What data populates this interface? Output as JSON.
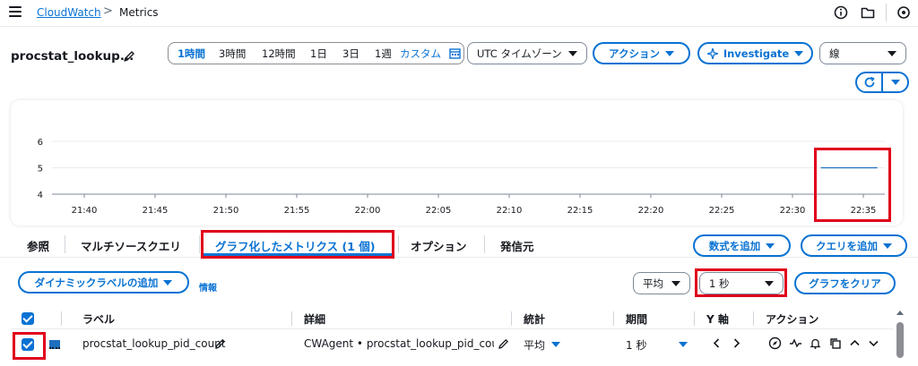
{
  "breadcrumb": {
    "root": "CloudWatch",
    "separator": ">",
    "current": "Metrics"
  },
  "title": {
    "text": "procstat_lookup..."
  },
  "time_range": {
    "options": [
      "1時間",
      "3時間",
      "12時間",
      "1日",
      "3日",
      "1週"
    ],
    "selected": "1時間",
    "custom": "カスタム"
  },
  "timezone": {
    "value": "UTC タイムゾーン"
  },
  "actions": {
    "label": "アクション"
  },
  "investigate": {
    "label": "Investigate"
  },
  "graph_type": {
    "value": "線"
  },
  "chart_data": {
    "type": "line",
    "x_ticks": [
      "21:40",
      "21:45",
      "21:50",
      "21:55",
      "22:00",
      "22:05",
      "22:10",
      "22:15",
      "22:20",
      "22:25",
      "22:30",
      "22:35"
    ],
    "y_ticks": [
      4,
      5,
      6
    ],
    "ylim": [
      4,
      6
    ],
    "series": [
      {
        "color": "#1f6fbf",
        "x": [
          "22:32",
          "22:36"
        ],
        "values": [
          5,
          5
        ]
      }
    ]
  },
  "tabs": {
    "items": [
      {
        "label": "参照"
      },
      {
        "label": "マルチソースクエリ"
      },
      {
        "label": "グラフ化したメトリクス (1 個)"
      },
      {
        "label": "オプション"
      },
      {
        "label": "発信元"
      }
    ],
    "selected_index": 2
  },
  "buttons": {
    "add_math": "数式を追加",
    "add_query": "クエリを追加",
    "add_dynamic_label": "ダイナミックラベルの追加",
    "info": "情報",
    "clear_graph": "グラフをクリア"
  },
  "stat_select": {
    "value": "平均"
  },
  "period_select": {
    "value": "1 秒"
  },
  "table": {
    "headers": [
      "ラベル",
      "詳細",
      "統計",
      "期間",
      "Y 軸",
      "アクション"
    ],
    "rows": [
      {
        "label": "procstat_lookup_pid_count",
        "details": "CWAgent • procstat_lookup_pid_count • ",
        "stat": "平均",
        "period": "1 秒",
        "color": "#1f6fbf",
        "checked": true
      }
    ]
  },
  "colors": {
    "accent": "#0972d3",
    "highlight": "#e0001b"
  }
}
